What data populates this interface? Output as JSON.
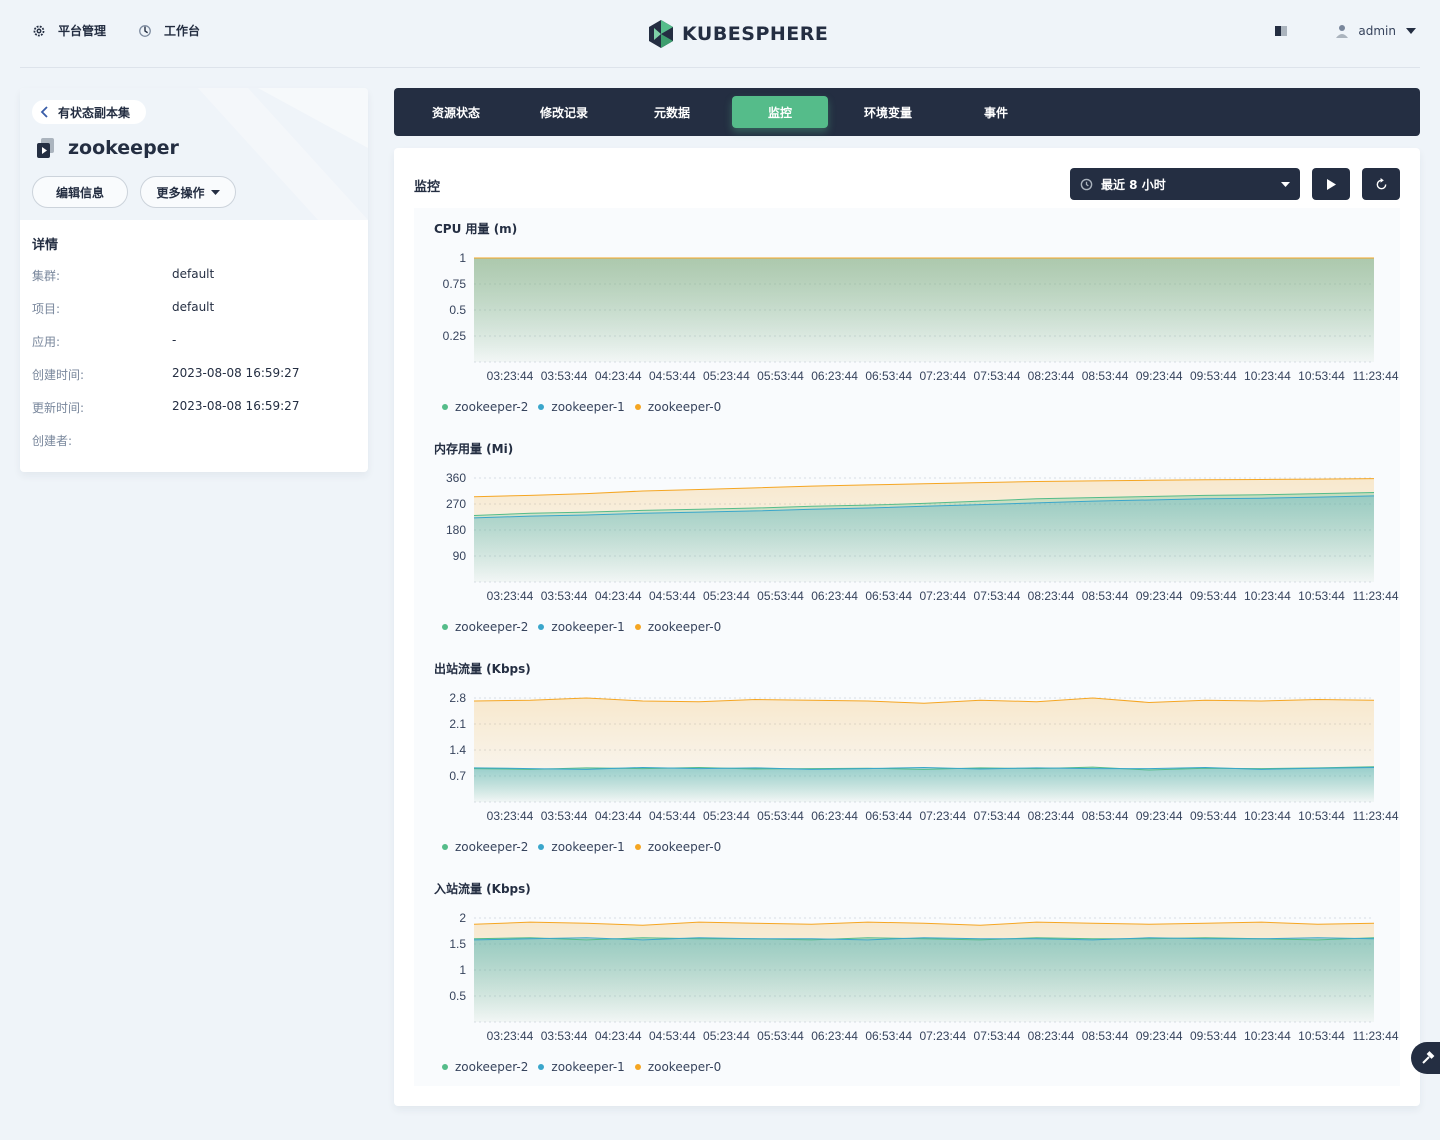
{
  "nav": {
    "platform_label": "平台管理",
    "workbench_label": "工作台",
    "logo_text": "KUBESPHERE",
    "user_name": "admin"
  },
  "resource": {
    "back_label": "有状态副本集",
    "name": "zookeeper",
    "edit_label": "编辑信息",
    "more_label": "更多操作",
    "details_title": "详情",
    "details": [
      {
        "key": "集群:",
        "value": "default"
      },
      {
        "key": "项目:",
        "value": "default"
      },
      {
        "key": "应用:",
        "value": "-"
      },
      {
        "key": "创建时间:",
        "value": "2023-08-08 16:59:27"
      },
      {
        "key": "更新时间:",
        "value": "2023-08-08 16:59:27"
      },
      {
        "key": "创建者:",
        "value": ""
      }
    ]
  },
  "tabs": [
    {
      "label": "资源状态",
      "active": false
    },
    {
      "label": "修改记录",
      "active": false
    },
    {
      "label": "元数据",
      "active": false
    },
    {
      "label": "监控",
      "active": true
    },
    {
      "label": "环境变量",
      "active": false
    },
    {
      "label": "事件",
      "active": false
    }
  ],
  "monitor": {
    "title": "监控",
    "time_range": "最近 8 小时"
  },
  "colors": {
    "zookeeper-2": "#55bc8a",
    "zookeeper-1": "#3aa6cb",
    "zookeeper-0": "#f5a623",
    "accent": "#55bc8a",
    "dark": "#242e42"
  },
  "chart_data": [
    {
      "type": "area",
      "title": "CPU 用量 (m)",
      "ylim": [
        0,
        1
      ],
      "yticks": [
        "1",
        "0.75",
        "0.5",
        "0.25"
      ],
      "x": [
        "03:23:44",
        "03:53:44",
        "04:23:44",
        "04:53:44",
        "05:23:44",
        "05:53:44",
        "06:23:44",
        "06:53:44",
        "07:23:44",
        "07:53:44",
        "08:23:44",
        "08:53:44",
        "09:23:44",
        "09:53:44",
        "10:23:44",
        "10:53:44",
        "11:23:44"
      ],
      "series": [
        {
          "name": "zookeeper-2",
          "values": [
            1,
            1,
            1,
            1,
            1,
            1,
            1,
            1,
            1,
            1,
            1,
            1,
            1,
            1,
            1,
            1,
            1
          ]
        },
        {
          "name": "zookeeper-1",
          "values": [
            1,
            1,
            1,
            1,
            1,
            1,
            1,
            1,
            1,
            1,
            1,
            1,
            1,
            1,
            1,
            1,
            1
          ]
        },
        {
          "name": "zookeeper-0",
          "values": [
            1,
            1,
            1,
            1,
            1,
            1,
            1,
            1,
            1,
            1,
            1,
            1,
            1,
            1,
            1,
            1,
            1
          ]
        }
      ]
    },
    {
      "type": "area",
      "title": "内存用量 (Mi)",
      "ylim": [
        0,
        360
      ],
      "yticks": [
        "360",
        "270",
        "180",
        "90"
      ],
      "x": [
        "03:23:44",
        "03:53:44",
        "04:23:44",
        "04:53:44",
        "05:23:44",
        "05:53:44",
        "06:23:44",
        "06:53:44",
        "07:23:44",
        "07:53:44",
        "08:23:44",
        "08:53:44",
        "09:23:44",
        "09:53:44",
        "10:23:44",
        "10:53:44",
        "11:23:44"
      ],
      "series": [
        {
          "name": "zookeeper-2",
          "values": [
            230,
            238,
            242,
            248,
            252,
            256,
            262,
            266,
            272,
            280,
            288,
            292,
            296,
            300,
            302,
            306,
            310
          ]
        },
        {
          "name": "zookeeper-1",
          "values": [
            222,
            228,
            232,
            238,
            242,
            246,
            252,
            256,
            262,
            268,
            274,
            280,
            284,
            288,
            290,
            294,
            298
          ]
        },
        {
          "name": "zookeeper-0",
          "values": [
            295,
            300,
            306,
            315,
            320,
            326,
            332,
            336,
            340,
            344,
            348,
            350,
            352,
            354,
            355,
            356,
            358
          ]
        }
      ]
    },
    {
      "type": "area",
      "title": "出站流量 (Kbps)",
      "ylim": [
        0,
        2.8
      ],
      "yticks": [
        "2.8",
        "2.1",
        "1.4",
        "0.7"
      ],
      "x": [
        "03:23:44",
        "03:53:44",
        "04:23:44",
        "04:53:44",
        "05:23:44",
        "05:53:44",
        "06:23:44",
        "06:53:44",
        "07:23:44",
        "07:53:44",
        "08:23:44",
        "08:53:44",
        "09:23:44",
        "09:53:44",
        "10:23:44",
        "10:53:44",
        "11:23:44"
      ],
      "series": [
        {
          "name": "zookeeper-2",
          "values": [
            0.9,
            0.88,
            0.92,
            0.9,
            0.93,
            0.89,
            0.9,
            0.91,
            0.88,
            0.92,
            0.9,
            0.94,
            0.86,
            0.91,
            0.9,
            0.92,
            0.95
          ]
        },
        {
          "name": "zookeeper-1",
          "values": [
            0.92,
            0.9,
            0.88,
            0.93,
            0.9,
            0.92,
            0.88,
            0.9,
            0.93,
            0.89,
            0.92,
            0.9,
            0.9,
            0.93,
            0.88,
            0.91,
            0.93
          ]
        },
        {
          "name": "zookeeper-0",
          "values": [
            2.72,
            2.74,
            2.8,
            2.72,
            2.7,
            2.76,
            2.74,
            2.72,
            2.66,
            2.74,
            2.7,
            2.8,
            2.68,
            2.74,
            2.72,
            2.76,
            2.74
          ]
        }
      ]
    },
    {
      "type": "area",
      "title": "入站流量 (Kbps)",
      "ylim": [
        0,
        2
      ],
      "yticks": [
        "2",
        "1.5",
        "1",
        "0.5"
      ],
      "x": [
        "03:23:44",
        "03:53:44",
        "04:23:44",
        "04:53:44",
        "05:23:44",
        "05:53:44",
        "06:23:44",
        "06:53:44",
        "07:23:44",
        "07:53:44",
        "08:23:44",
        "08:53:44",
        "09:23:44",
        "09:53:44",
        "10:23:44",
        "10:53:44",
        "11:23:44"
      ],
      "series": [
        {
          "name": "zookeeper-2",
          "values": [
            1.6,
            1.62,
            1.58,
            1.62,
            1.6,
            1.6,
            1.58,
            1.62,
            1.6,
            1.58,
            1.62,
            1.6,
            1.6,
            1.62,
            1.6,
            1.58,
            1.62
          ]
        },
        {
          "name": "zookeeper-1",
          "values": [
            1.58,
            1.6,
            1.62,
            1.58,
            1.62,
            1.6,
            1.6,
            1.58,
            1.62,
            1.6,
            1.6,
            1.58,
            1.62,
            1.6,
            1.6,
            1.62,
            1.6
          ]
        },
        {
          "name": "zookeeper-0",
          "values": [
            1.88,
            1.92,
            1.9,
            1.86,
            1.92,
            1.9,
            1.88,
            1.92,
            1.9,
            1.86,
            1.92,
            1.9,
            1.88,
            1.9,
            1.92,
            1.88,
            1.9
          ]
        }
      ]
    }
  ]
}
